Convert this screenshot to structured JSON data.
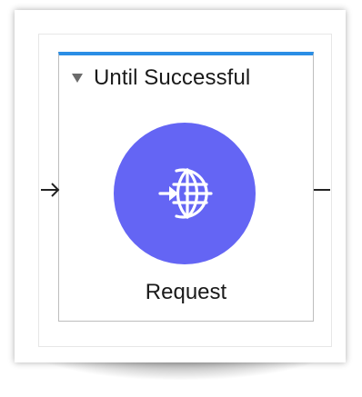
{
  "scope": {
    "title": "Until Successful",
    "accent_color": "#2a8ee5",
    "collapsed": false
  },
  "component": {
    "label": "Request",
    "icon": "globe-request-icon",
    "color": "#6465f4"
  },
  "connectors": {
    "incoming": "arrow-right",
    "outgoing": "line"
  }
}
